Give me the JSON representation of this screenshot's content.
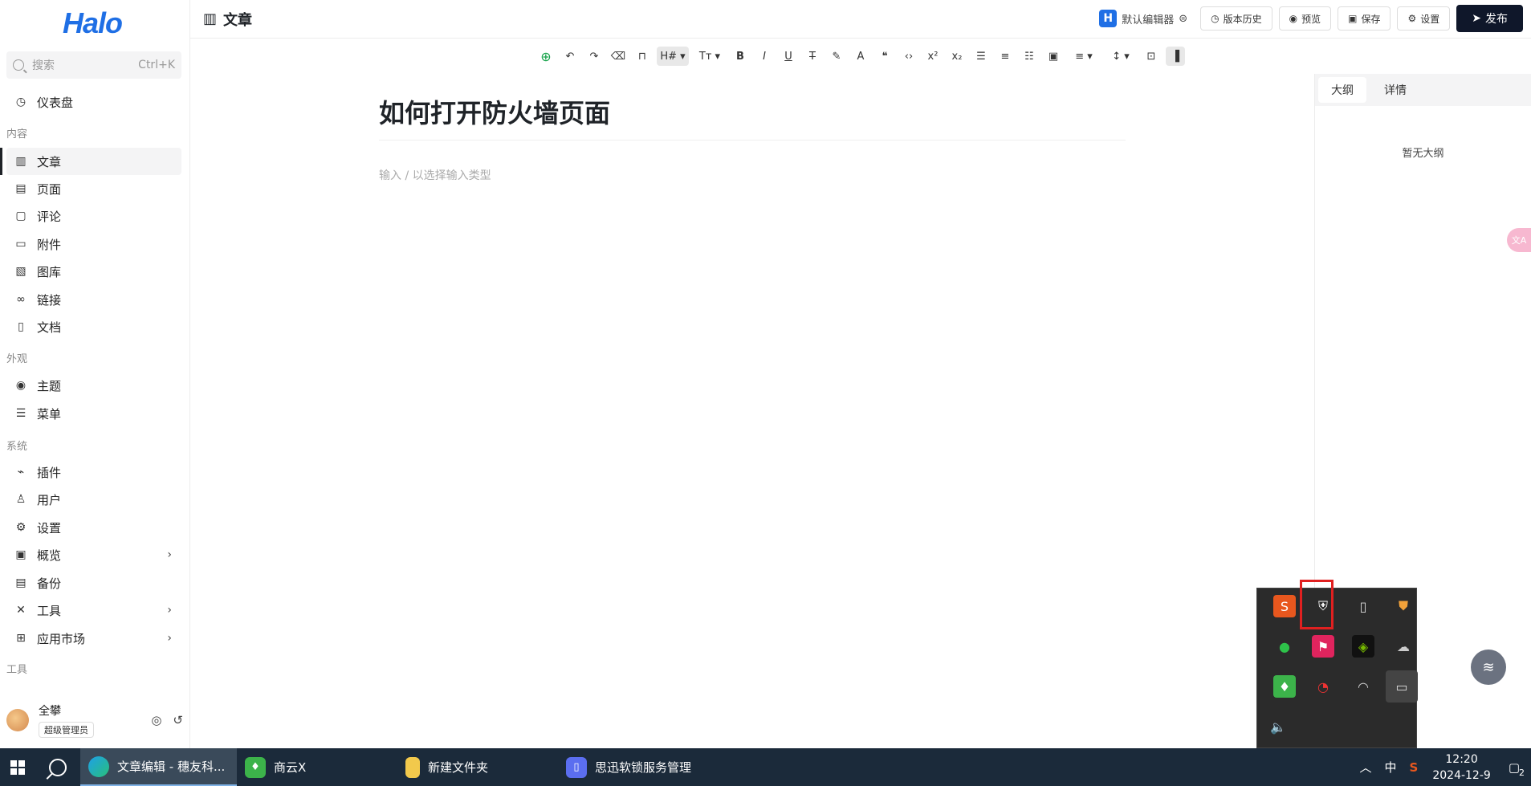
{
  "sidebar": {
    "logo": "Halo",
    "search": {
      "placeholder": "搜索",
      "shortcut": "Ctrl+K"
    },
    "sections": {
      "content": "内容",
      "appearance": "外观",
      "system": "系统",
      "tools": "工具"
    },
    "items": [
      {
        "label": "仪表盘",
        "icon": "dashboard-icon"
      },
      {
        "label": "文章",
        "icon": "post-icon"
      },
      {
        "label": "页面",
        "icon": "page-icon"
      },
      {
        "label": "评论",
        "icon": "comment-icon"
      },
      {
        "label": "附件",
        "icon": "folder-icon"
      },
      {
        "label": "图库",
        "icon": "image-icon"
      },
      {
        "label": "链接",
        "icon": "link-icon"
      },
      {
        "label": "文档",
        "icon": "doc-icon"
      },
      {
        "label": "主题",
        "icon": "palette-icon"
      },
      {
        "label": "菜单",
        "icon": "menu-icon"
      },
      {
        "label": "插件",
        "icon": "plug-icon"
      },
      {
        "label": "用户",
        "icon": "user-icon"
      },
      {
        "label": "设置",
        "icon": "gear-icon"
      },
      {
        "label": "概览",
        "icon": "terminal-icon"
      },
      {
        "label": "备份",
        "icon": "backup-icon"
      },
      {
        "label": "工具",
        "icon": "tools-icon"
      },
      {
        "label": "应用市场",
        "icon": "apps-icon"
      }
    ],
    "user": {
      "name": "全攀",
      "role": "超级管理员"
    }
  },
  "header": {
    "title": "文章",
    "editor_name": "默认编辑器",
    "history": "版本历史",
    "preview": "预览",
    "save": "保存",
    "settings": "设置",
    "publish": "发布"
  },
  "editor": {
    "title": "如何打开防火墙页面",
    "placeholder": "输入 / 以选择输入类型"
  },
  "right_panel": {
    "tabs": [
      "大纲",
      "详情"
    ],
    "empty": "暂无大纲"
  },
  "taskbar": {
    "tasks": [
      "文章编辑 - 穗友科...",
      "商云X",
      "新建文件夹",
      "思迅软锁服务管理"
    ],
    "ime": "中",
    "time": "12:20",
    "date": "2024-12-9",
    "notifications": "2"
  },
  "colors": {
    "brand": "#1f6fe5",
    "primary_button": "#0f172a",
    "taskbar": "#1b2a3a",
    "highlight": "#e02020"
  }
}
